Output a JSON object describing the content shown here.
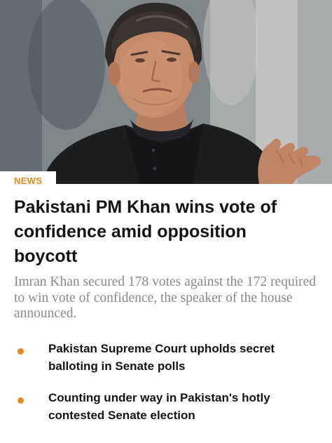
{
  "article": {
    "category": "NEWS",
    "headline": "Pakistani PM Khan wins vote of confidence amid opposition boycott",
    "summary": "Imran Khan secured 178 votes against the 172 required to win vote of confidence, the speaker of the house announced."
  },
  "related": [
    {
      "title": "Pakistan Supreme Court upholds secret balloting in Senate polls"
    },
    {
      "title": "Counting under way in Pakistan's hotly contested Senate election"
    }
  ],
  "colors": {
    "accent": "#e58a1f",
    "headline": "#141414",
    "summary": "#8a8a8a"
  }
}
